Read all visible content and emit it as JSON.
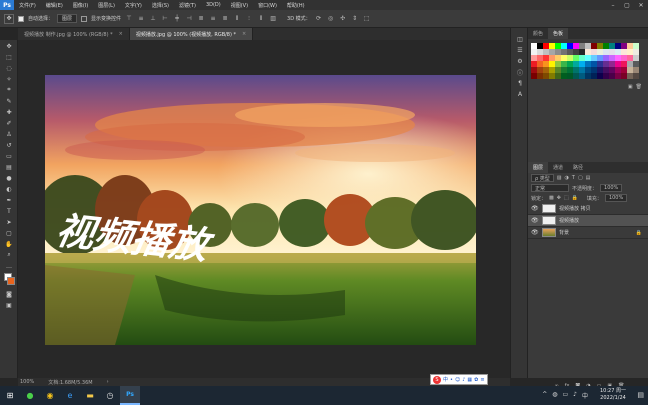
{
  "menubar": {
    "logo": "Ps",
    "items": [
      "文件(F)",
      "编辑(E)",
      "图像(I)",
      "图层(L)",
      "文字(Y)",
      "选择(S)",
      "滤镜(T)",
      "3D(D)",
      "视图(V)",
      "窗口(W)",
      "帮助(H)"
    ]
  },
  "options": {
    "auto_select_label": "自动选择：",
    "auto_select_value": "图层",
    "show_transform_label": "显示变换控件",
    "three_d_label": "3D 模式："
  },
  "tabs": [
    {
      "label": "视频播放 制作.jpg @ 100% (RGB/8) *",
      "active": false
    },
    {
      "label": "视频播放.jpg @ 100% (视频播放, RGB/8) *",
      "active": true
    }
  ],
  "canvas_text": "视频播放",
  "status": {
    "zoom": "100%",
    "doc": "文档:1.68M/5.36M"
  },
  "panels": {
    "color_tabs": [
      "颜色",
      "色板"
    ],
    "layers_tabs": [
      "图层",
      "通道",
      "路径"
    ],
    "filter_label": "ρ 类型",
    "blend_mode": "正常",
    "opacity_label": "不透明度：",
    "opacity_value": "100%",
    "lock_label": "锁定：",
    "fill_label": "填充：",
    "fill_value": "100%"
  },
  "swatch_colors": [
    "#ffffff",
    "#000000",
    "#ff0000",
    "#ffff00",
    "#00ff00",
    "#00ffff",
    "#0000ff",
    "#ff00ff",
    "#808080",
    "#c0c0c0",
    "#800000",
    "#808000",
    "#008000",
    "#008080",
    "#000080",
    "#800080",
    "#ffcc99",
    "#ccffcc",
    "#f2f2f2",
    "#d9d9d9",
    "#bfbfbf",
    "#a6a6a6",
    "#8c8c8c",
    "#737373",
    "#595959",
    "#404040",
    "#262626",
    "#fde9d9",
    "#f2dcdb",
    "#ebf1de",
    "#dce6f1",
    "#e4dfec",
    "#daeef3",
    "#fde9d9",
    "#fff2cc",
    "#eeece1",
    "#ff9999",
    "#ff6666",
    "#ff3333",
    "#ff9966",
    "#ffcc66",
    "#ffff66",
    "#ccff66",
    "#66ff66",
    "#66ffcc",
    "#66ffff",
    "#66ccff",
    "#6699ff",
    "#9966ff",
    "#cc66ff",
    "#ff66ff",
    "#ff66cc",
    "#ff6699",
    "#cccccc",
    "#ed1c24",
    "#f26522",
    "#f7941d",
    "#fff200",
    "#8dc63f",
    "#39b54a",
    "#00a651",
    "#00a99d",
    "#00aeef",
    "#0072bc",
    "#0054a6",
    "#2e3192",
    "#662d91",
    "#92278f",
    "#ec008c",
    "#ed145b",
    "#a7a9ac",
    "#58595b",
    "#9e0b0f",
    "#a0410d",
    "#a36209",
    "#aba000",
    "#598527",
    "#197b30",
    "#007236",
    "#00746b",
    "#0076a3",
    "#004a80",
    "#003471",
    "#1b1464",
    "#440e62",
    "#630460",
    "#9e005d",
    "#9e0039",
    "#c7b299",
    "#998675",
    "#790000",
    "#7b2e00",
    "#7d4900",
    "#827b00",
    "#406618",
    "#005e20",
    "#005826",
    "#005952",
    "#005b7f",
    "#003663",
    "#002157",
    "#0d004c",
    "#32004b",
    "#4b0049",
    "#7b0046",
    "#7a0026",
    "#736357",
    "#534741"
  ],
  "layers": [
    {
      "name": "视频播放 拷贝",
      "visible": true,
      "selected": false
    },
    {
      "name": "视频播放",
      "visible": true,
      "selected": true
    },
    {
      "name": "背景",
      "visible": true,
      "selected": false
    }
  ],
  "taskbar": {
    "time": "10:27 周一",
    "date": "2022/1/24"
  },
  "ime": {
    "label": "中"
  }
}
